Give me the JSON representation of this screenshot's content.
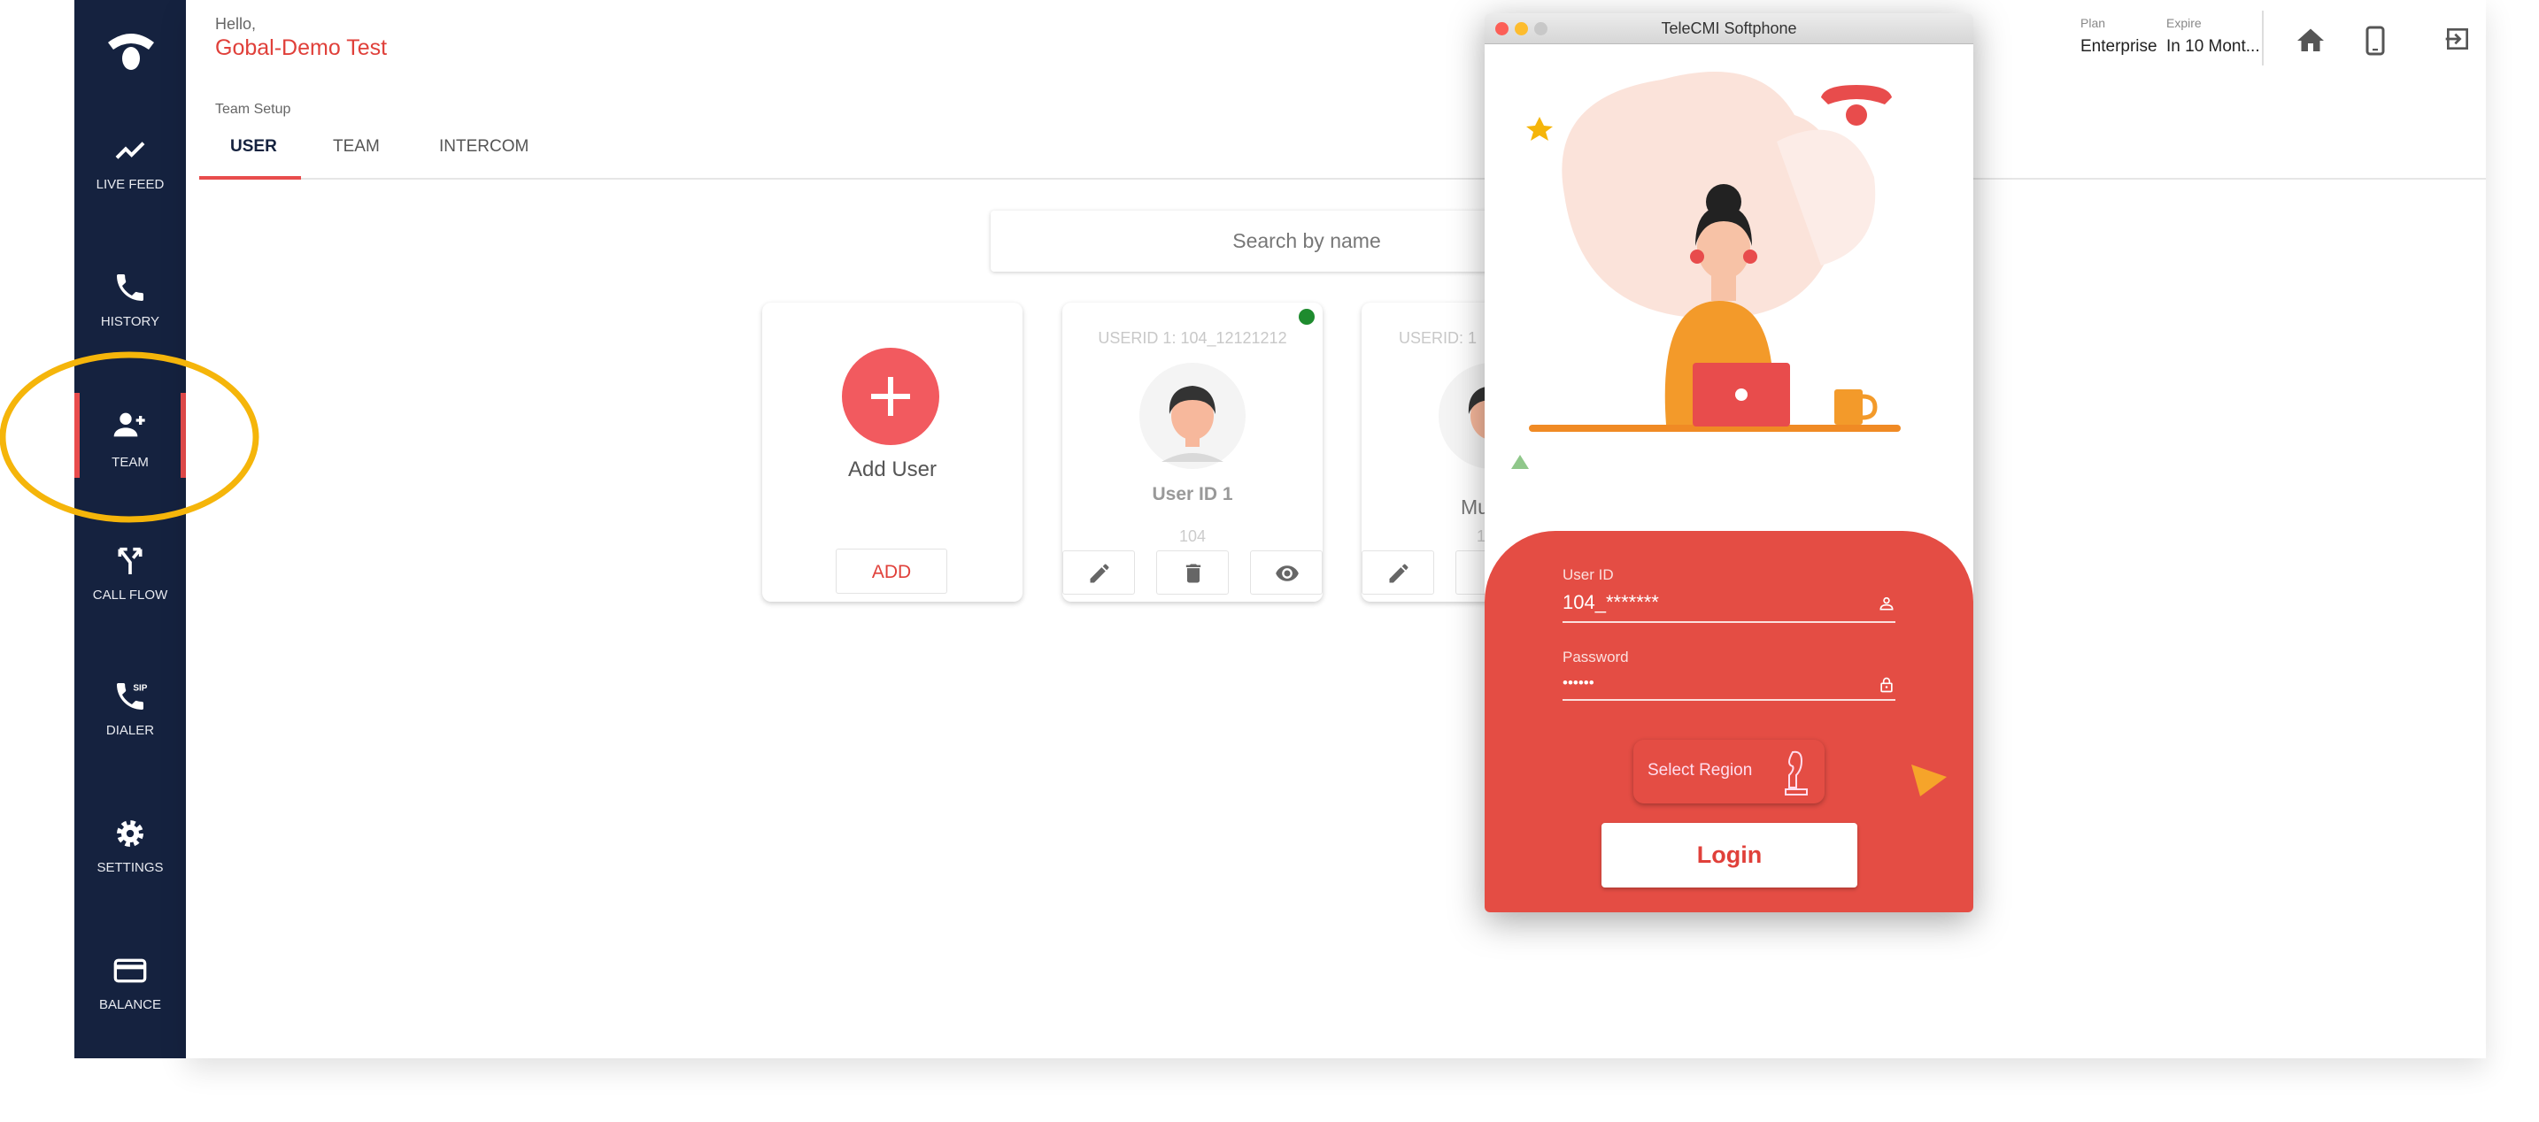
{
  "sidebar": {
    "items": [
      {
        "label": "LIVE FEED",
        "icon": "trending-up-icon"
      },
      {
        "label": "HISTORY",
        "icon": "phone-icon"
      },
      {
        "label": "TEAM",
        "icon": "person-add-icon",
        "active": true
      },
      {
        "label": "CALL FLOW",
        "icon": "call-split-icon"
      },
      {
        "label": "DIALER",
        "icon": "sip-phone-icon"
      },
      {
        "label": "SETTINGS",
        "icon": "gear-icon"
      },
      {
        "label": "BALANCE",
        "icon": "credit-card-icon"
      }
    ]
  },
  "header": {
    "greeting": "Hello,",
    "account_name": "Gobal-Demo Test",
    "plan_label": "Plan",
    "plan_value": "Enterprise",
    "expire_label": "Expire",
    "expire_value": "In 10 Mont..."
  },
  "page": {
    "section_title": "Team Setup",
    "tabs": [
      {
        "label": "USER",
        "active": true
      },
      {
        "label": "TEAM"
      },
      {
        "label": "INTERCOM"
      }
    ],
    "search": {
      "placeholder": "Search by name"
    }
  },
  "cards": {
    "add": {
      "label": "Add User",
      "button": "ADD"
    },
    "users": [
      {
        "userid": "USERID 1: 104_12121212",
        "name": "User ID 1",
        "extension": "104",
        "online": true
      },
      {
        "userid": "USERID: 1",
        "name": "Mu",
        "extension": "1"
      }
    ]
  },
  "softphone": {
    "title": "TeleCMI Softphone",
    "userid_label": "User ID",
    "userid_value": "104_*******",
    "password_label": "Password",
    "password_value": "••••••",
    "region_button": "Select Region",
    "login_button": "Login"
  },
  "colors": {
    "sidebar": "#15223f",
    "accent": "#e84c4c",
    "highlight_circle": "#f5b50a",
    "online": "#1e8b2e"
  }
}
